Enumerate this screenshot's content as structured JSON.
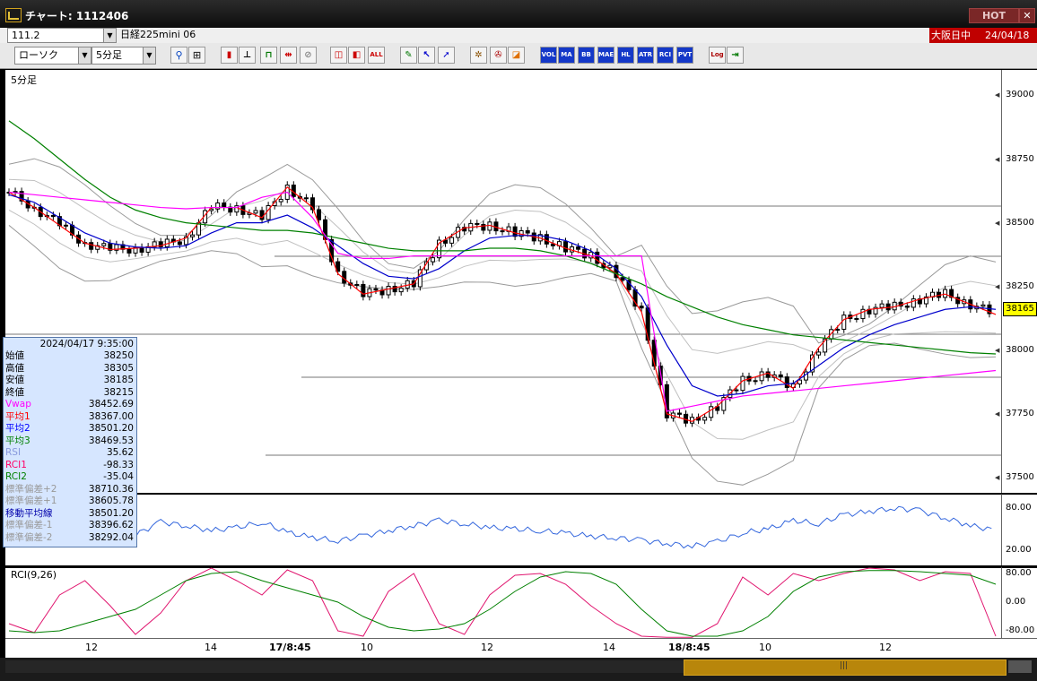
{
  "window": {
    "title": "チャート: 1112406",
    "hot_label": "HOT",
    "close_label": "✕"
  },
  "symbol_bar": {
    "code": "111.2",
    "name": "日経225mini 06",
    "market": "大阪日中",
    "date": "24/04/18"
  },
  "toolbar": {
    "chart_type": "ローソク",
    "timeframe": "5分足",
    "buttons": [
      "zoom",
      "cursor",
      "candle",
      "bar",
      "line",
      "split",
      "stamp",
      "box",
      "box2",
      "all",
      "draw",
      "select",
      "arrow",
      "fib",
      "wrench",
      "palette",
      "vol",
      "ma",
      "bb",
      "mae",
      "hl",
      "atr",
      "rci",
      "pvt",
      "log",
      "export"
    ],
    "button_labels": {
      "vol": "VOL",
      "ma": "MA",
      "bb": "BB",
      "mae": "MAE",
      "hl": "HL",
      "atr": "ATR",
      "rci": "RCI",
      "pvt": "PVT",
      "all": "ALL",
      "log": "Log"
    }
  },
  "panels": {
    "main_label": "5分足",
    "rci_label": "RCI(9,26)"
  },
  "last_price": "38165",
  "info": {
    "datetime": "2024/04/17 9:35:00",
    "rows": [
      {
        "k": "始値",
        "v": "38250",
        "color": "#000000"
      },
      {
        "k": "高値",
        "v": "38305",
        "color": "#000000"
      },
      {
        "k": "安値",
        "v": "38185",
        "color": "#000000"
      },
      {
        "k": "終値",
        "v": "38215",
        "color": "#000000"
      },
      {
        "k": "Vwap",
        "v": "38452.69",
        "color": "#ff00ff"
      },
      {
        "k": "平均1",
        "v": "38367.00",
        "color": "#ff0000"
      },
      {
        "k": "平均2",
        "v": "38501.20",
        "color": "#0000ff"
      },
      {
        "k": "平均3",
        "v": "38469.53",
        "color": "#008000"
      },
      {
        "k": "RSI",
        "v": "35.62",
        "color": "#8899dd"
      },
      {
        "k": "RCI1",
        "v": "-98.33",
        "color": "#ff0066"
      },
      {
        "k": "RCI2",
        "v": "-35.04",
        "color": "#008000"
      },
      {
        "k": "標準偏差+2",
        "v": "38710.36",
        "color": "#999999"
      },
      {
        "k": "標準偏差+1",
        "v": "38605.78",
        "color": "#999999"
      },
      {
        "k": "移動平均線",
        "v": "38501.20",
        "color": "#0000aa"
      },
      {
        "k": "標準偏差-1",
        "v": "38396.62",
        "color": "#999999"
      },
      {
        "k": "標準偏差-2",
        "v": "38292.04",
        "color": "#999999"
      }
    ]
  },
  "chart_data": [
    {
      "type": "line",
      "title": "5分足",
      "y_ticks": [
        39000,
        38750,
        38500,
        38250,
        38000,
        37750,
        37500
      ],
      "ylim": [
        37440,
        39100
      ],
      "x_ticks": [
        "12",
        "14",
        "17/8:45",
        "10",
        "12",
        "14",
        "18/8:45",
        "10",
        "12"
      ],
      "series": [
        {
          "name": "平均1",
          "color": "#ff0000",
          "values": [
            38620,
            38560,
            38490,
            38420,
            38395,
            38400,
            38410,
            38440,
            38560,
            38560,
            38520,
            38640,
            38560,
            38300,
            38220,
            38240,
            38260,
            38420,
            38480,
            38490,
            38460,
            38440,
            38400,
            38370,
            38300,
            38150,
            37750,
            37720,
            37780,
            37880,
            37910,
            37850,
            38010,
            38120,
            38160,
            38170,
            38200,
            38220,
            38180,
            38140
          ]
        },
        {
          "name": "平均2",
          "color": "#0000cc",
          "values": [
            38610,
            38580,
            38520,
            38460,
            38420,
            38405,
            38400,
            38410,
            38460,
            38500,
            38500,
            38530,
            38480,
            38410,
            38340,
            38290,
            38280,
            38320,
            38390,
            38440,
            38450,
            38450,
            38430,
            38390,
            38320,
            38210,
            38020,
            37860,
            37820,
            37830,
            37860,
            37870,
            37940,
            38010,
            38060,
            38100,
            38130,
            38160,
            38170,
            38160
          ]
        },
        {
          "name": "平均3",
          "color": "#008000",
          "values": [
            38900,
            38830,
            38750,
            38670,
            38600,
            38550,
            38520,
            38500,
            38490,
            38480,
            38470,
            38470,
            38460,
            38440,
            38420,
            38400,
            38390,
            38390,
            38390,
            38400,
            38400,
            38390,
            38370,
            38340,
            38300,
            38260,
            38210,
            38170,
            38130,
            38100,
            38080,
            38060,
            38050,
            38040,
            38030,
            38020,
            38010,
            38000,
            37990,
            37985
          ]
        },
        {
          "name": "Vwap",
          "color": "#ff00ff",
          "values": [
            38620,
            38610,
            38600,
            38590,
            38580,
            38570,
            38560,
            38555,
            38560,
            38560,
            38600,
            38620,
            38520,
            38380,
            38360,
            38360,
            38370,
            38370,
            38370,
            38370,
            38370,
            38370,
            38370,
            38370,
            38370,
            38370,
            37760,
            37780,
            37800,
            37820,
            37830,
            37840,
            37850,
            37860,
            37870,
            37880,
            37890,
            37900,
            37910,
            37920
          ]
        }
      ],
      "bands": {
        "upper2_color": "#999999",
        "upper1_color": "#bbbbbb",
        "lower1_color": "#bbbbbb",
        "lower2_color": "#999999"
      }
    },
    {
      "type": "line",
      "title": "",
      "y_ticks": [
        80,
        20
      ],
      "ylim": [
        0,
        100
      ],
      "series": [
        {
          "name": "RSI",
          "color": "#3366dd",
          "values": [
            45,
            55,
            38,
            50,
            48,
            42,
            60,
            55,
            48,
            52,
            60,
            45,
            38,
            34,
            40,
            48,
            55,
            62,
            58,
            52,
            50,
            48,
            44,
            40,
            38,
            34,
            30,
            26,
            32,
            45,
            50,
            62,
            58,
            70,
            75,
            80,
            76,
            66,
            55,
            48
          ]
        }
      ]
    },
    {
      "type": "line",
      "title": "RCI(9,26)",
      "y_ticks": [
        80,
        0,
        -80
      ],
      "ylim": [
        -100,
        100
      ],
      "series": [
        {
          "name": "RCI1",
          "color": "#e0146e",
          "values": [
            -60,
            -85,
            20,
            60,
            -10,
            -90,
            -30,
            60,
            95,
            60,
            20,
            90,
            60,
            -80,
            -95,
            30,
            80,
            -60,
            -90,
            20,
            75,
            80,
            50,
            -10,
            -60,
            -95,
            -98,
            -98,
            -60,
            70,
            20,
            80,
            60,
            80,
            95,
            90,
            60,
            85,
            80,
            -95
          ]
        },
        {
          "name": "RCI2",
          "color": "#008000",
          "values": [
            -80,
            -85,
            -80,
            -60,
            -40,
            -20,
            20,
            60,
            80,
            85,
            60,
            40,
            20,
            0,
            -40,
            -70,
            -80,
            -75,
            -60,
            -20,
            30,
            70,
            85,
            80,
            50,
            -20,
            -80,
            -95,
            -95,
            -80,
            -40,
            30,
            70,
            85,
            88,
            88,
            85,
            80,
            75,
            50
          ]
        }
      ]
    }
  ]
}
